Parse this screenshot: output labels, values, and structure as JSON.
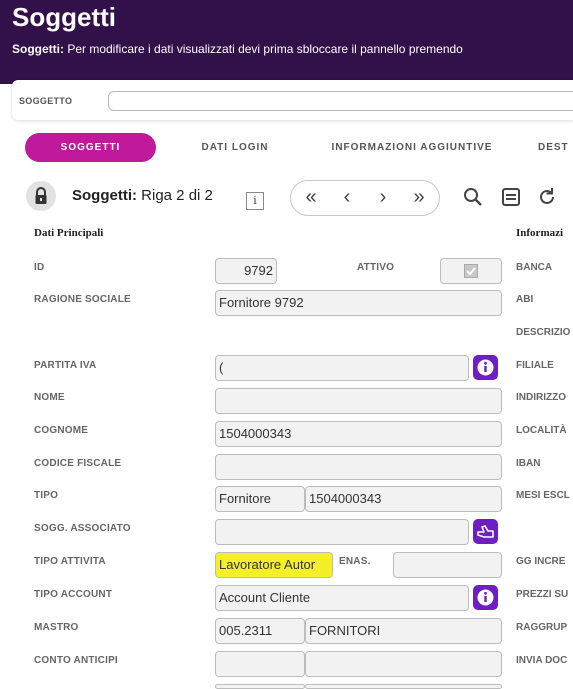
{
  "header": {
    "title": "Soggetti",
    "subtitle_prefix": "Soggetti:",
    "subtitle_text": " Per modificare i dati visualizzati devi prima sbloccare il pannello premendo"
  },
  "search": {
    "label": "SOGGETTO",
    "value": ""
  },
  "tabs": [
    {
      "label": "SOGGETTI",
      "active": true
    },
    {
      "label": "DATI LOGIN",
      "active": false
    },
    {
      "label": "INFORMAZIONI AGGIUNTIVE",
      "active": false
    },
    {
      "label": "DEST",
      "active": false
    }
  ],
  "toolbar": {
    "title_bold": "Soggetti:",
    "title_rest": " Riga 2 di 2",
    "info_glyph": "i",
    "pager": [
      "«",
      "‹",
      "›",
      "»"
    ],
    "icons": [
      "search-icon",
      "list-icon",
      "refresh-icon"
    ]
  },
  "sections": {
    "left": "Dati Principali",
    "right": "Informazi"
  },
  "fields": {
    "id": {
      "label": "ID",
      "value": "9792"
    },
    "attivo": {
      "label": "ATTIVO",
      "checked": true
    },
    "ragione_sociale": {
      "label": "RAGIONE SOCIALE",
      "value": "Fornitore 9792"
    },
    "partita_iva": {
      "label": "PARTITA IVA",
      "value": "("
    },
    "nome": {
      "label": "NOME",
      "value": ""
    },
    "cognome": {
      "label": "COGNOME",
      "value": "1504000343"
    },
    "codice_fiscale": {
      "label": "CODICE FISCALE",
      "value": ""
    },
    "tipo": {
      "label": "TIPO",
      "value": "Fornitore",
      "code": "1504000343"
    },
    "sogg_associato": {
      "label": "SOGG. ASSOCIATO",
      "value": ""
    },
    "tipo_attivita": {
      "label": "TIPO ATTIVITA",
      "value": "Lavoratore Autor"
    },
    "enas": {
      "label": "ENAS.",
      "value": ""
    },
    "tipo_account": {
      "label": "TIPO ACCOUNT",
      "value": "Account Cliente"
    },
    "mastro": {
      "label": "MASTRO",
      "value": "005.2311",
      "desc": "FORNITORI"
    },
    "conto_anticipi": {
      "label": "CONTO ANTICIPI",
      "value": "",
      "desc": ""
    }
  },
  "right_labels": [
    "BANCA",
    "ABI",
    "DESCRIZIO",
    "FILIALE",
    "INDIRIZZO",
    "LOCALITÀ",
    "IBAN",
    "MESI ESCL",
    "GG INCRE",
    "PREZZI SU",
    "RAGGRUP",
    "INVIA DOC"
  ],
  "colors": {
    "header_bg": "#32104a",
    "tab_active": "#c0199c",
    "accent_button": "#6d1fc4",
    "highlight": "#f5ef2a"
  }
}
